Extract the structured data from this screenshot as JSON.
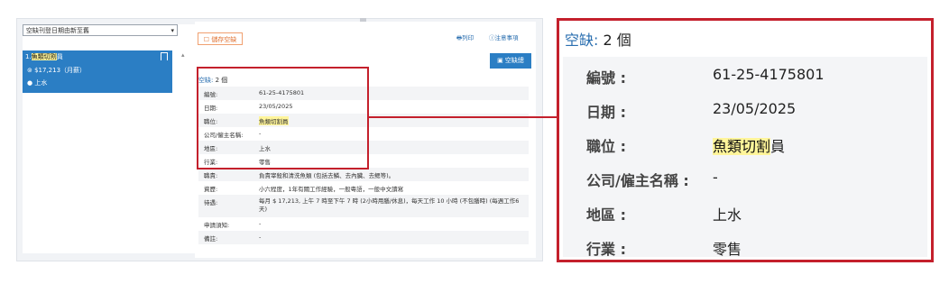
{
  "left": {
    "sort_select": "空缺刊登日期由新至舊",
    "job": {
      "index": "1.",
      "title_highlight": "魚類切割",
      "title_suffix": "員",
      "salary": "$17,213（月薪）",
      "location": "上水"
    }
  },
  "toolbar": {
    "save_label": "儲存空缺",
    "print_label": "列印",
    "notes_label": "注意事項",
    "apply_label": "空缺總"
  },
  "detail": {
    "vacancy_label": "空缺:",
    "vacancy_count": "2 個",
    "rows": [
      {
        "k": "編號:",
        "v": "61-25-4175801"
      },
      {
        "k": "日期:",
        "v": "23/05/2025"
      },
      {
        "k": "職位:",
        "v": "魚類切割員"
      },
      {
        "k": "公司/僱主名稱:",
        "v": "-"
      },
      {
        "k": "地區:",
        "v": "上水"
      },
      {
        "k": "行業:",
        "v": "零售"
      },
      {
        "k": "職責:",
        "v": "負責宰殺和清洗魚類 (包括去鱗、去內臟、去鰓等)。"
      },
      {
        "k": "資歷:",
        "v": "小六程度，1年有關工作經驗，一般粵語，一般中文讀寫"
      },
      {
        "k": "待遇:",
        "v": "每月 $ 17,213, 上午 7 時至下午 7 時 (2小時用膳/休息)，每天工作 10 小時 (不包膳時) (每週工作6天)"
      },
      {
        "k": "申請須知:",
        "v": "-"
      },
      {
        "k": "備註:",
        "v": "-"
      }
    ]
  },
  "zoom": {
    "vacancy_label": "空缺:",
    "vacancy_count": "2 個",
    "rows": [
      {
        "k": "編號 :",
        "v": "61-25-4175801"
      },
      {
        "k": "日期 :",
        "v": "23/05/2025"
      },
      {
        "k": "職位 :",
        "v_highlight": "魚類切割",
        "v_suffix": "員"
      },
      {
        "k": "公司/僱主名稱 :",
        "v": "-"
      },
      {
        "k": "地區 :",
        "v": "上水"
      },
      {
        "k": "行業 :",
        "v": "零售"
      }
    ]
  },
  "colors": {
    "accent": "#2b7ec4",
    "highlight_box": "#c4202c",
    "marker": "#fff59a"
  }
}
